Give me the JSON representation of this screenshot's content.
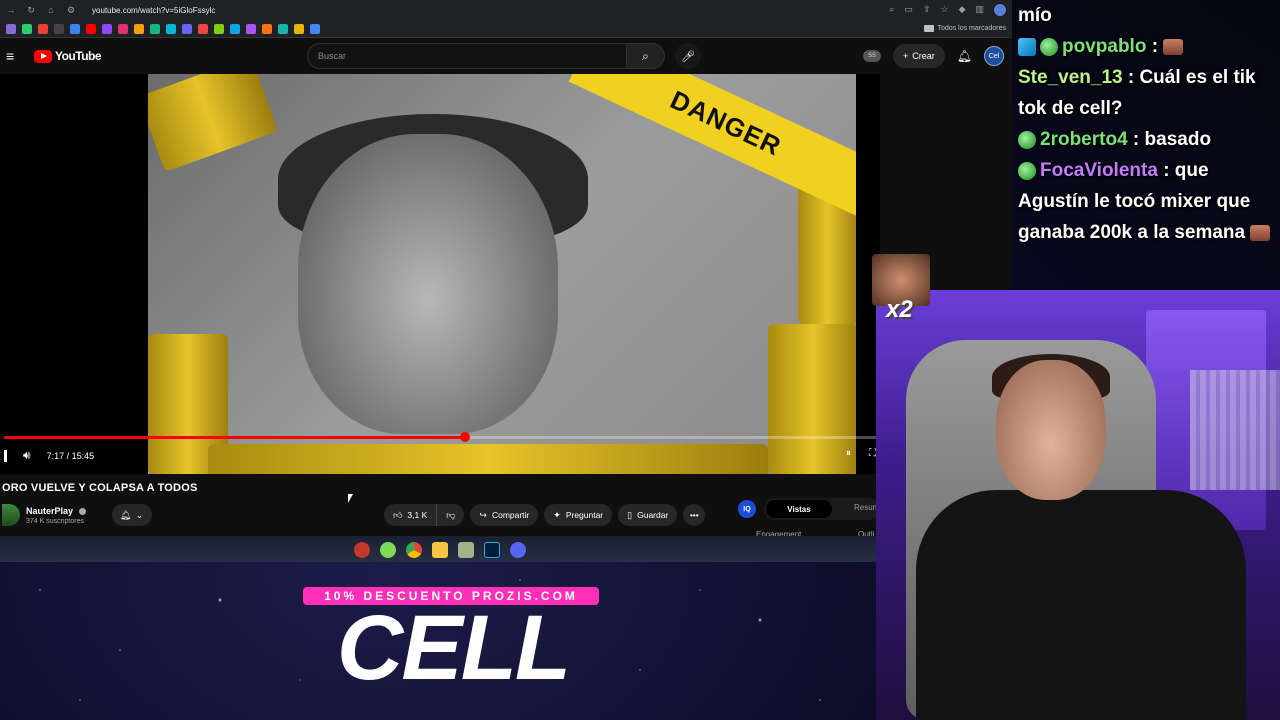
{
  "browser": {
    "url": "youtube.com/watch?v=5iGloFssylc",
    "bookmarks_folder": "Todos los marcadores"
  },
  "youtube": {
    "logo_text": "YouTube",
    "search_placeholder": "Buscar",
    "ss_badge": "SS",
    "create_label": "Crear",
    "avatar_text": "Cel"
  },
  "player": {
    "danger_text": "DANGER",
    "time": "7:17 / 15:45",
    "progress_fraction": 0.529
  },
  "video": {
    "title": "ORO VUELVE Y COLAPSA A TODOS",
    "channel_name": "NauterPlay",
    "subscribers": "374 K suscriptores",
    "likes": "3,1 K",
    "share_label": "Compartir",
    "ask_label": "Preguntar",
    "save_label": "Guardar"
  },
  "side_panel": {
    "iq_label": "IQ",
    "tab_active": "Vistas",
    "tab_other": "Resum",
    "engagement_label": "Engagement",
    "outline_label": "Outli"
  },
  "chat": {
    "messages": [
      {
        "user": "",
        "text": "mío"
      },
      {
        "user": "povpablo",
        "text": ":"
      },
      {
        "user": "Ste_ven_13",
        "text": ": Cuál es el tik tok de cell?"
      },
      {
        "user": "2roberto4",
        "text": ": basado"
      },
      {
        "user": "FocaViolenta",
        "text": ": que Agustín le tocó mixer que ganaba 200k a la semana"
      }
    ]
  },
  "overlay": {
    "emote_multiplier": "x2",
    "promo_text": "10% DESCUENTO PROZIS.COM",
    "brand_text": "CELL"
  },
  "colors": {
    "youtube_red": "#ff0000",
    "promo_pink": "#ff2fb8",
    "chat_green": "#7ee07a",
    "chat_purple": "#c27cff"
  }
}
